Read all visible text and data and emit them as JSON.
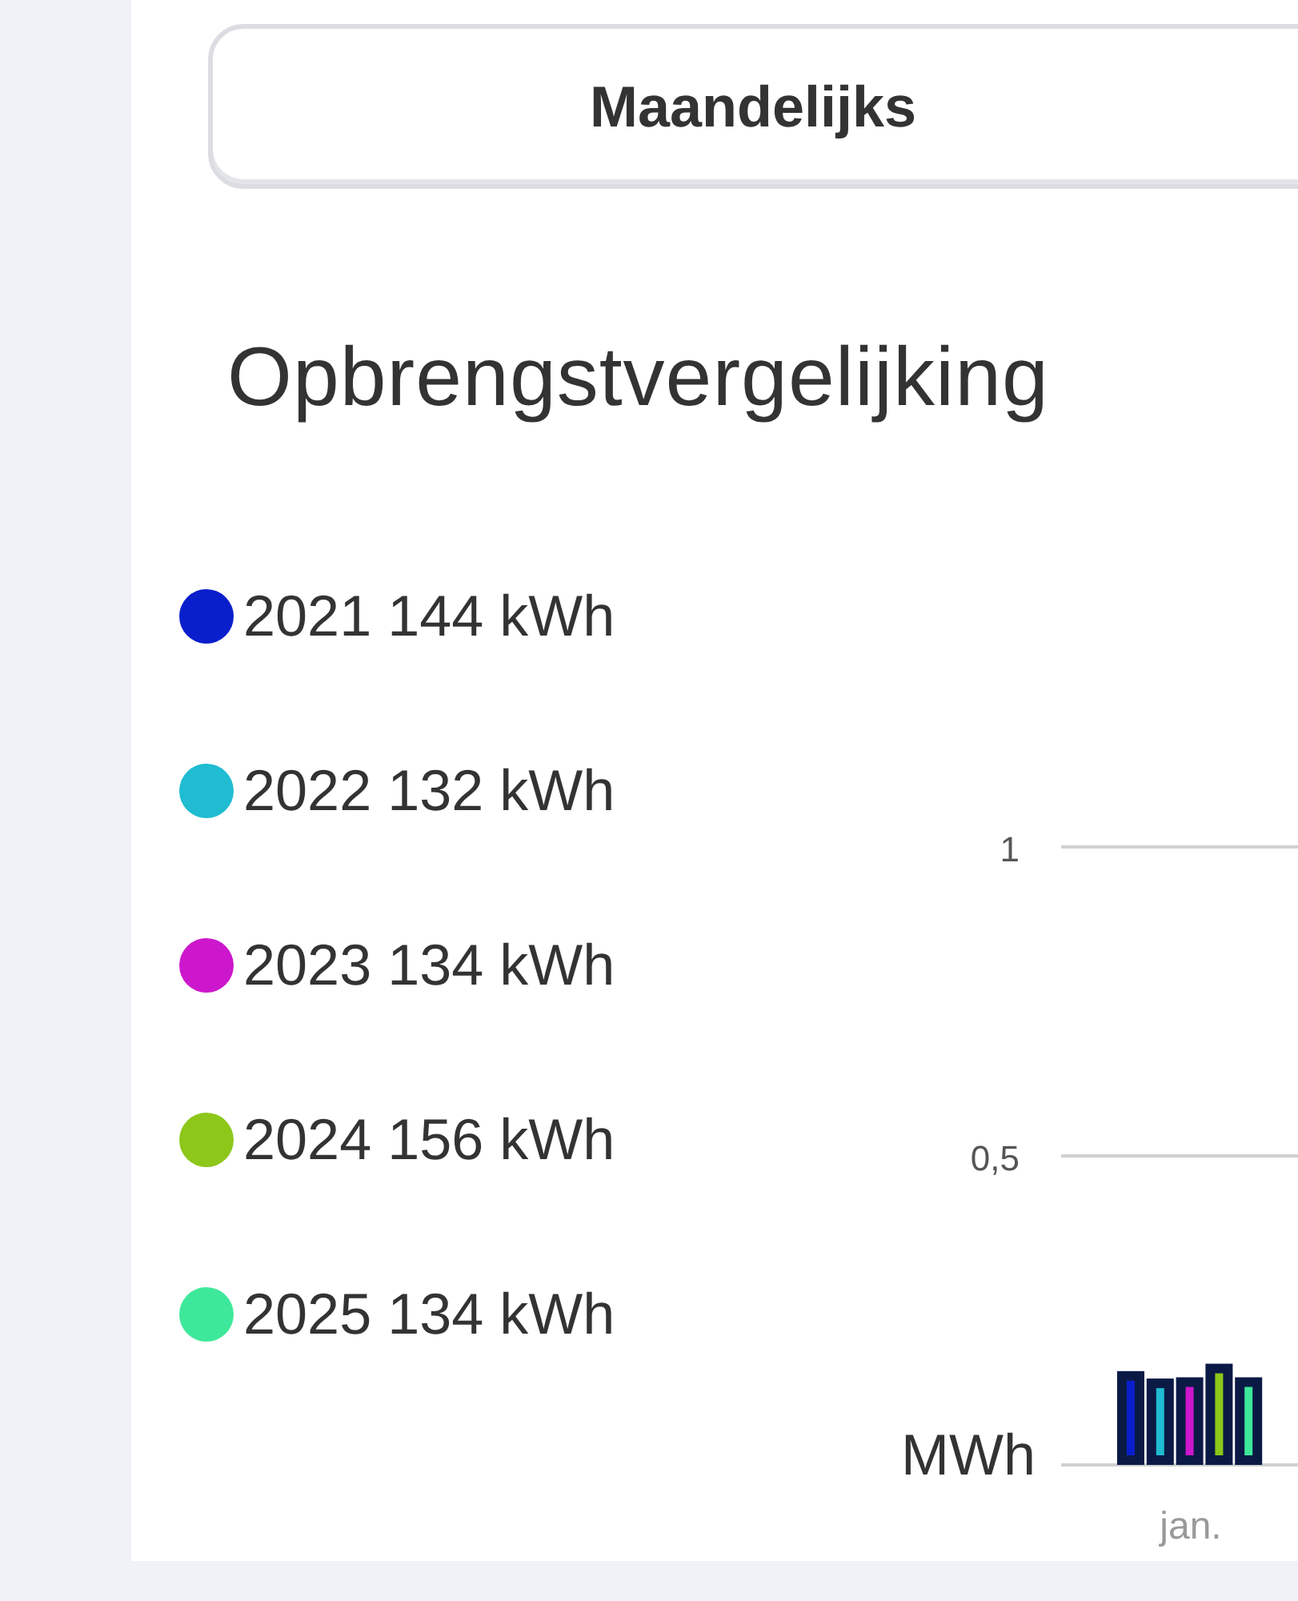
{
  "period_button": {
    "label": "Maandelijks"
  },
  "title": "Opbrengstvergelijking",
  "legend": [
    {
      "label": "2021 144 kWh",
      "color": "#0a1fcc"
    },
    {
      "label": "2022 132 kWh",
      "color": "#1fbcd2"
    },
    {
      "label": "2023 134 kWh",
      "color": "#cc17cc"
    },
    {
      "label": "2024 156 kWh",
      "color": "#8cc71a"
    },
    {
      "label": "2025 134 kWh",
      "color": "#3ee89a"
    }
  ],
  "chart": {
    "chart_data": {
      "type": "bar",
      "categories": [
        "jan."
      ],
      "ylim": [
        0,
        1
      ],
      "ylabel": "MWh",
      "yticks": [
        {
          "value": 0.5,
          "label": "0,5"
        },
        {
          "value": 1,
          "label": "1"
        }
      ],
      "series": [
        {
          "color": "#0a1fcc",
          "values": [
            0.144
          ]
        },
        {
          "color": "#1fbcd2",
          "values": [
            0.132
          ]
        },
        {
          "color": "#cc17cc",
          "values": [
            0.134
          ]
        },
        {
          "color": "#8cc71a",
          "values": [
            0.156
          ]
        },
        {
          "color": "#3ee89a",
          "values": [
            0.134
          ]
        }
      ]
    }
  }
}
